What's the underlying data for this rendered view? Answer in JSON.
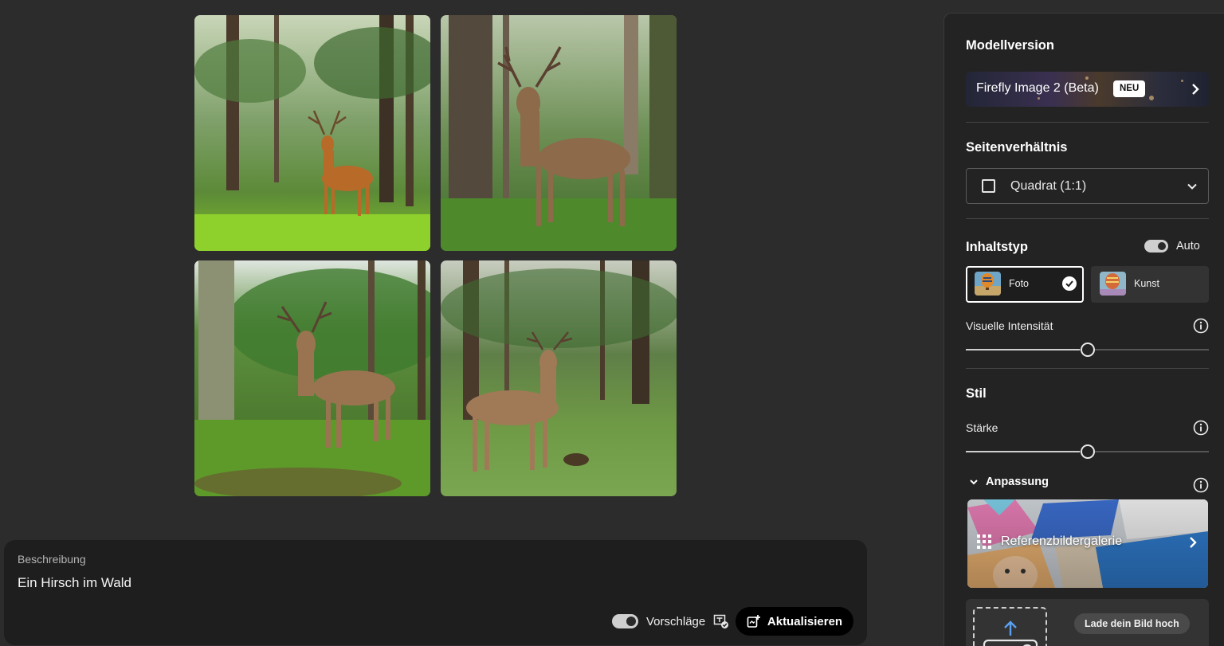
{
  "images": [
    {
      "label": "Generiertes Bild 1"
    },
    {
      "label": "Generiertes Bild 2"
    },
    {
      "label": "Generiertes Bild 3"
    },
    {
      "label": "Generiertes Bild 4"
    }
  ],
  "prompt": {
    "label": "Beschreibung",
    "text": "Ein Hirsch im Wald",
    "suggestions_label": "Vorschläge",
    "suggestions_enabled": true,
    "update_button": "Aktualisieren"
  },
  "panel": {
    "model": {
      "heading": "Modellversion",
      "name": "Firefly Image 2 (Beta)",
      "badge": "NEU"
    },
    "aspect": {
      "heading": "Seitenverhältnis",
      "value": "Quadrat (1:1)"
    },
    "content_type": {
      "heading": "Inhaltstyp",
      "auto_label": "Auto",
      "auto_enabled": true,
      "options": [
        {
          "label": "Foto",
          "selected": true
        },
        {
          "label": "Kunst",
          "selected": false
        }
      ]
    },
    "intensity": {
      "label": "Visuelle Intensität",
      "value_fraction": 0.5
    },
    "style": {
      "heading": "Stil",
      "strength_label": "Stärke",
      "strength_fraction": 0.5
    },
    "customize": {
      "label": "Anpassung",
      "gallery_label": "Referenzbildergalerie",
      "upload_button": "Lade dein Bild hoch"
    }
  },
  "colors": {
    "background": "#2c2c2c",
    "panel": "#232323",
    "prompt_bar": "#1e1e1e",
    "accent": "#ffffff"
  }
}
